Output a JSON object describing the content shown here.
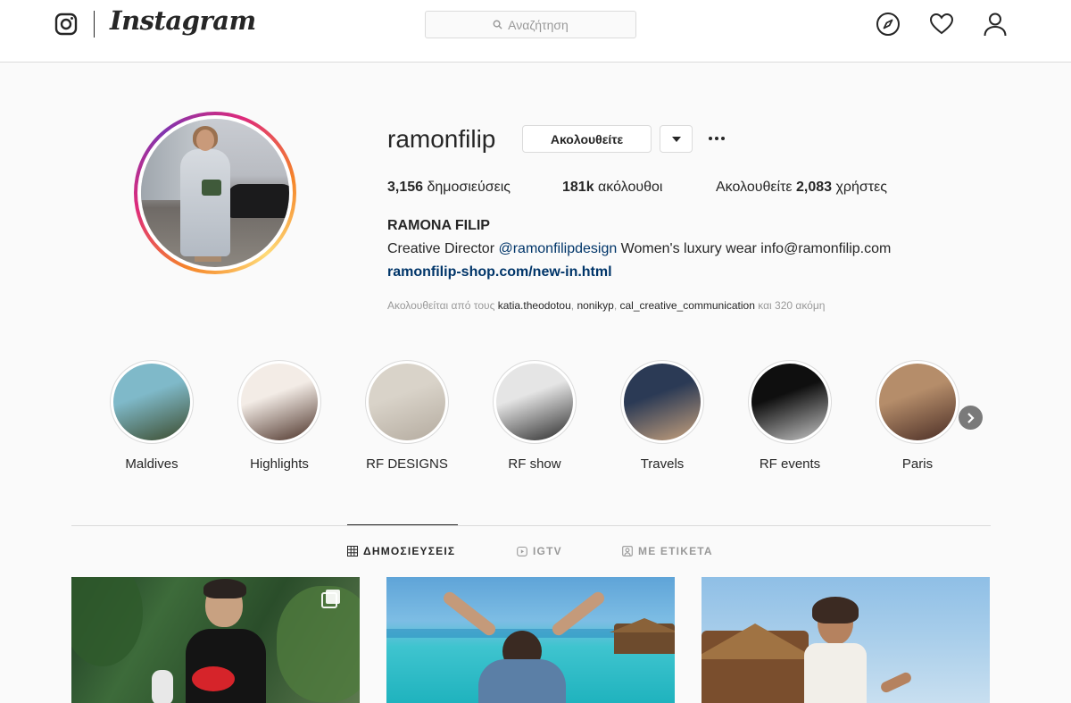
{
  "nav": {
    "wordmark": "Instagram",
    "search_placeholder": "Αναζήτηση",
    "icons": [
      "instagram-glyph-icon",
      "explore-compass-icon",
      "heart-icon",
      "profile-person-icon"
    ]
  },
  "profile": {
    "username": "ramonfilip",
    "follow_label": "Ακολουθείτε",
    "stats": {
      "posts_count": "3,156",
      "posts_label": "δημοσιεύσεις",
      "followers_count": "181k",
      "followers_label": "ακόλουθοι",
      "following_prefix": "Ακολουθείτε",
      "following_count": "2,083",
      "following_suffix": "χρήστες"
    },
    "full_name": "RAMONA FILIP",
    "bio": {
      "prefix": "Creative Director ",
      "mention": "@ramonfilipdesign",
      "suffix": " Women's luxury wear info@ramonfilip.com"
    },
    "link": "ramonfilip-shop.com/new-in.html",
    "followed_by": {
      "prefix": "Ακολουθείται από τους ",
      "users": [
        "katia.theodotou",
        "nonikyp",
        "cal_creative_communication"
      ],
      "suffix": " και 320 ακόμη"
    }
  },
  "highlights": [
    {
      "label": "Maldives",
      "color1": "#7fb9c9",
      "color2": "#3b4a2b"
    },
    {
      "label": "Highlights",
      "color1": "#f3ece6",
      "color2": "#4b3127"
    },
    {
      "label": "RF DESIGNS",
      "color1": "#d9d3c9",
      "color2": "#b4ab9f"
    },
    {
      "label": "RF show",
      "color1": "#e5e5e5",
      "color2": "#2a2a2a"
    },
    {
      "label": "Travels",
      "color1": "#2b3a55",
      "color2": "#c8a27d"
    },
    {
      "label": "RF events",
      "color1": "#0f0f0f",
      "color2": "#c7c7c7"
    },
    {
      "label": "Paris",
      "color1": "#b58d6a",
      "color2": "#4a2d25"
    }
  ],
  "tabs": [
    {
      "label": "ΔΗΜΟΣΙΕΥΣΕΙΣ",
      "icon": "grid-icon",
      "active": true
    },
    {
      "label": "IGTV",
      "icon": "igtv-icon",
      "active": false
    },
    {
      "label": "ΜΕ ΕΤΙΚΕΤΑ",
      "icon": "tagged-icon",
      "active": false
    }
  ],
  "colors": {
    "link": "#003569",
    "text": "#262626",
    "muted": "#999999",
    "border": "#dbdbdb"
  }
}
